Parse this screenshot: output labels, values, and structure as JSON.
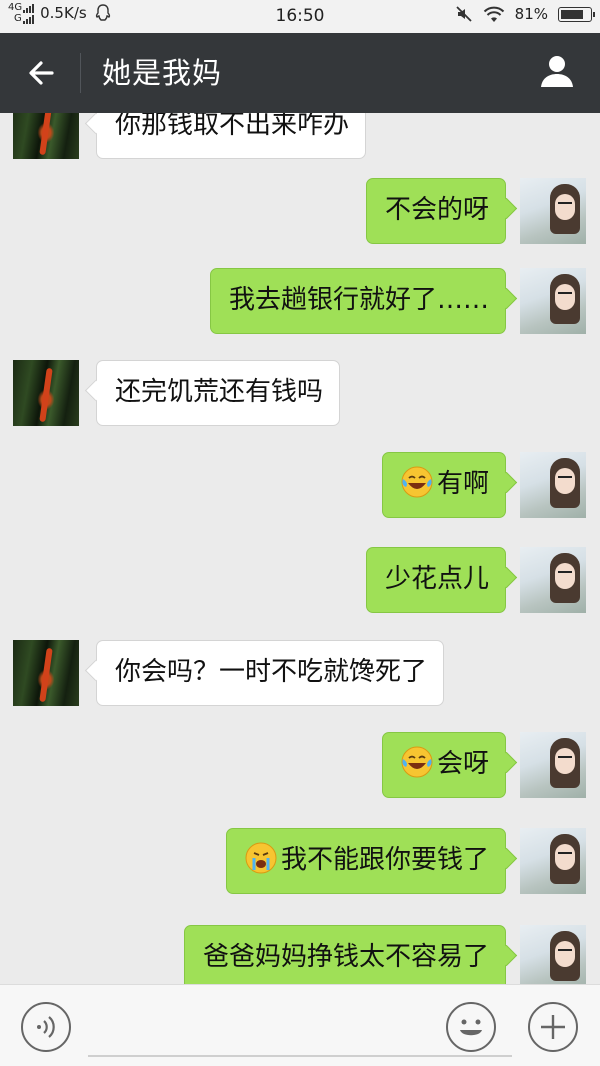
{
  "status_bar": {
    "network": "4G",
    "network2": "G",
    "speed": "0.5K/s",
    "time": "16:50",
    "battery_percent": "81%",
    "battery_level": 0.81,
    "icons": [
      "signal-icon",
      "qq-icon",
      "mute-icon",
      "wifi-icon",
      "battery-icon"
    ]
  },
  "header": {
    "title": "她是我妈",
    "back_icon": "arrow-left-icon",
    "profile_icon": "person-icon"
  },
  "messages": [
    {
      "side": "in",
      "text": "你那钱取不出来咋办"
    },
    {
      "side": "out",
      "text": "不会的呀"
    },
    {
      "side": "out",
      "text": "我去趟银行就好了……"
    },
    {
      "side": "in",
      "text": "还完饥荒还有钱吗"
    },
    {
      "side": "out",
      "emoji": "laugh-cry-emoji",
      "text": "有啊"
    },
    {
      "side": "out",
      "text": "少花点儿"
    },
    {
      "side": "in",
      "text": "你会吗？一时不吃就馋死了"
    },
    {
      "side": "out",
      "emoji": "laugh-cry-emoji",
      "text": "会呀"
    },
    {
      "side": "out",
      "emoji": "crying-emoji",
      "text": "我不能跟你要钱了"
    },
    {
      "side": "out",
      "text": "爸爸妈妈挣钱太不容易了"
    }
  ],
  "input_bar": {
    "voice_icon": "voice-icon",
    "emoji_icon": "smiley-icon",
    "plus_icon": "plus-icon",
    "placeholder": ""
  },
  "colors": {
    "titlebar": "#34373a",
    "outgoing_bubble": "#9fe057",
    "incoming_bubble": "#ffffff",
    "background": "#ebebeb"
  }
}
